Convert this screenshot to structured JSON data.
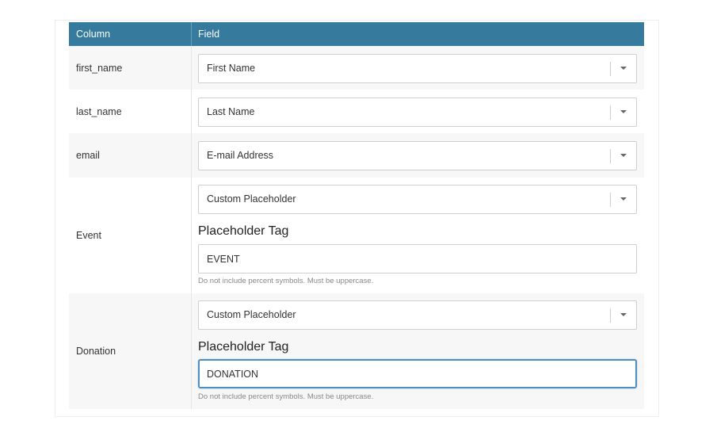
{
  "table": {
    "header": {
      "column": "Column",
      "field": "Field"
    },
    "rows": [
      {
        "column": "first_name",
        "field_value": "First Name"
      },
      {
        "column": "last_name",
        "field_value": "Last Name"
      },
      {
        "column": "email",
        "field_value": "E-mail Address"
      },
      {
        "column": "Event",
        "field_value": "Custom Placeholder",
        "placeholder_heading": "Placeholder Tag",
        "tag_value": "EVENT",
        "help": "Do not include percent symbols. Must be uppercase."
      },
      {
        "column": "Donation",
        "field_value": "Custom Placeholder",
        "placeholder_heading": "Placeholder Tag",
        "tag_value": "DONATION",
        "help": "Do not include percent symbols. Must be uppercase."
      }
    ]
  },
  "colors": {
    "header_bg": "#367b9e",
    "focus_border": "#4f8fc0",
    "alt_row_bg": "#f7f7f7"
  },
  "icons": {
    "dropdown": "chevron-down-icon"
  }
}
